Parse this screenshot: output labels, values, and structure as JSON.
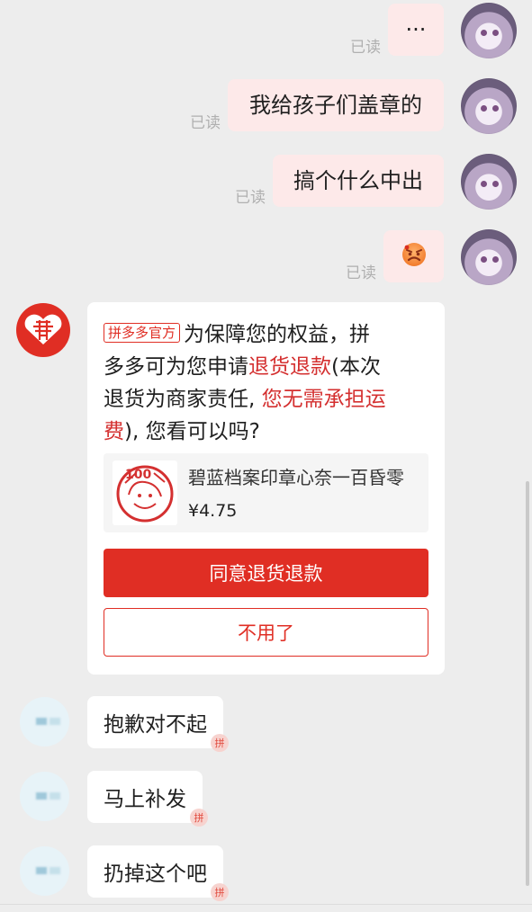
{
  "messages": {
    "outgoing": [
      {
        "text": "···",
        "status": "已读"
      },
      {
        "text": "我给孩子们盖章的",
        "status": "已读"
      },
      {
        "text": "搞个什么中出",
        "status": "已读"
      },
      {
        "emoji": "angry-face",
        "status": "已读"
      }
    ],
    "official_card": {
      "tag": "拼多多官方",
      "line1": "为保障您的权益，拼",
      "line2_prefix": "多多可为您申请",
      "line2_highlight": "退货退款",
      "line2_suffix": "(本次",
      "line3_prefix": "退货为商家责任, ",
      "line3_highlight": "您无需承担运",
      "line4_highlight": "费",
      "line4_suffix": "), 您看可以吗?",
      "product": {
        "title": "碧蓝档案印章心奈一百昏零",
        "price": "¥4.75",
        "stamp_text": "100"
      },
      "buttons": {
        "agree": "同意退货退款",
        "decline": "不用了"
      }
    },
    "incoming": [
      {
        "text": "抱歉对不起"
      },
      {
        "text": "马上补发"
      },
      {
        "text": "扔掉这个吧"
      }
    ]
  },
  "colors": {
    "background": "#ededed",
    "outgoing_bubble": "#fde9e9",
    "incoming_bubble": "#ffffff",
    "brand_red": "#e02e24",
    "highlight_red": "#d43030"
  },
  "icons": {
    "official_avatar": "pinduoduo-heart-logo",
    "angry_emoji": "angry-face-icon"
  }
}
